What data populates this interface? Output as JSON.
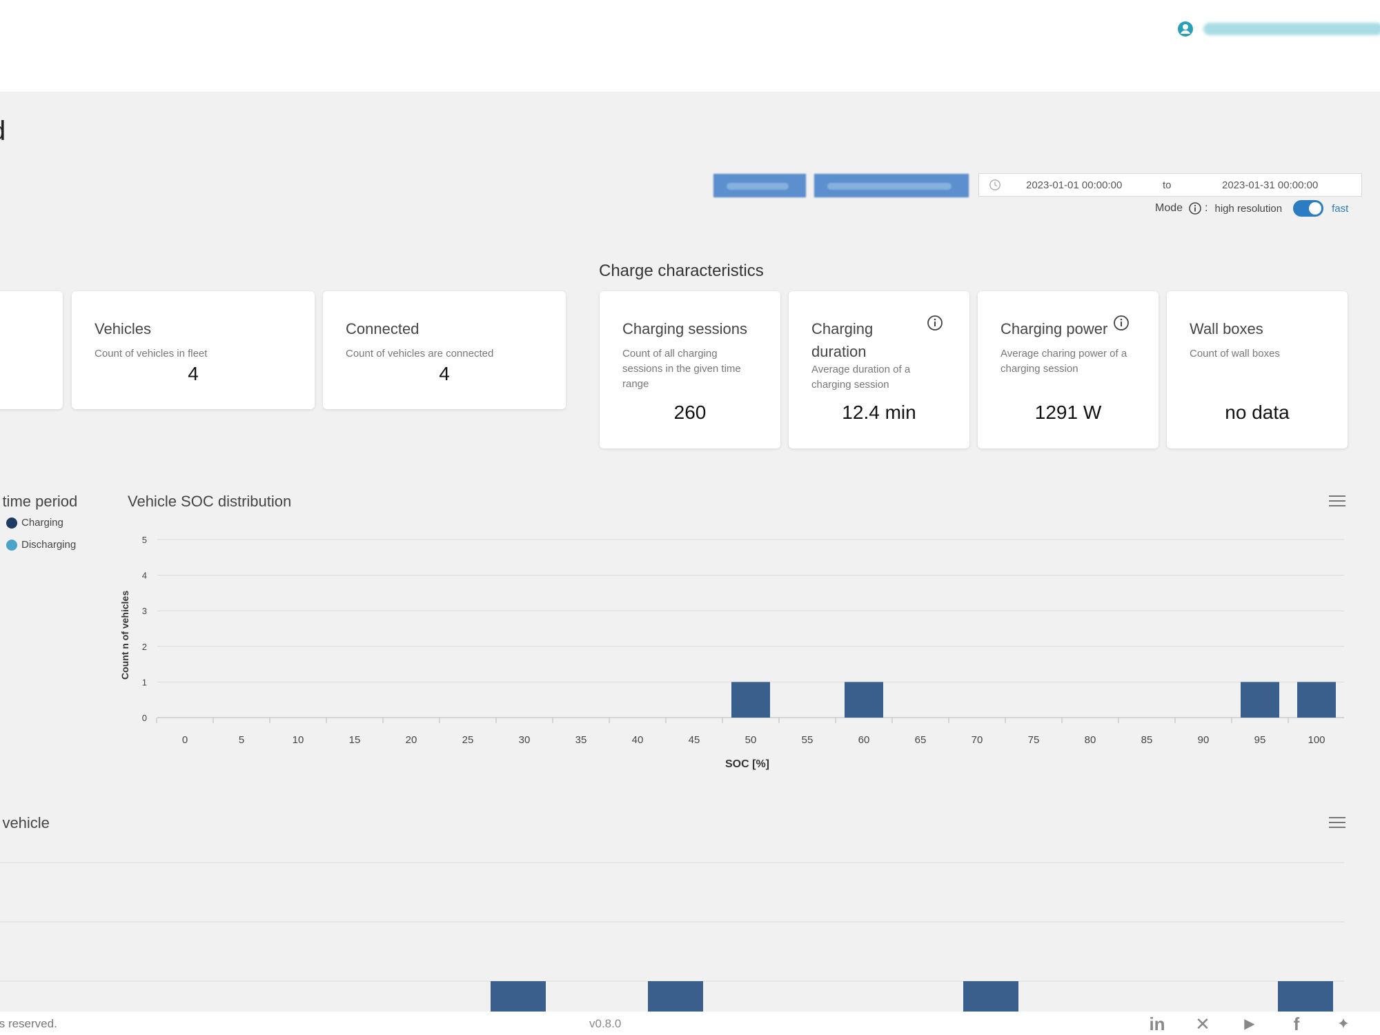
{
  "header": {
    "title": "d"
  },
  "filters": {
    "date_from": "2023-01-01 00:00:00",
    "date_separator": "to",
    "date_to": "2023-01-31 00:00:00",
    "mode_label": "Mode",
    "mode_colon": ":",
    "mode_left": "high resolution",
    "mode_right": "fast"
  },
  "fleet_cards": [
    {
      "title": "Vehicles",
      "description": "Count of vehicles in fleet",
      "value": "4"
    },
    {
      "title": "Connected",
      "description": "Count of vehicles are connected",
      "value": "4"
    }
  ],
  "charge": {
    "section_title": "Charge characteristics",
    "cards": [
      {
        "title_line1": "Charging sessions",
        "title_line2": "",
        "description": "Count of all charging sessions in the given time range",
        "value": "260"
      },
      {
        "title_line1": "Charging",
        "title_line2": "duration",
        "description": "Average duration of a charging session",
        "value": "12.4 min"
      },
      {
        "title_line1": "Charging power",
        "title_line2": "",
        "description": "Average charing power of a charging session",
        "value": "1291 W"
      },
      {
        "title_line1": "Wall boxes",
        "title_line2": "",
        "description": "Count of wall boxes",
        "value": "no data"
      }
    ]
  },
  "left_panel": {
    "title": "r time period",
    "legend": [
      {
        "name": "Charging",
        "color": "#1f3b63"
      },
      {
        "name": "Discharging",
        "color": "#4aa3c8"
      }
    ]
  },
  "bottom_panel": {
    "title": "r vehicle"
  },
  "footer": {
    "copyright": "ts reserved.",
    "version": "v0.8.0",
    "social": [
      "linkedin-icon",
      "xing-icon",
      "youtube-icon",
      "facebook-icon",
      "twitter-icon"
    ]
  },
  "colors": {
    "bar": "#3b5f8c",
    "accent": "#2c7cc4",
    "filter_button": "#5b8fcd"
  },
  "chart_data": {
    "type": "bar",
    "title": "Vehicle SOC distribution",
    "xlabel": "SOC [%]",
    "ylabel": "Count n of vehicles",
    "x": [
      0,
      5,
      10,
      15,
      20,
      25,
      30,
      35,
      40,
      45,
      50,
      55,
      60,
      65,
      70,
      75,
      80,
      85,
      90,
      95,
      100
    ],
    "values": [
      0,
      0,
      0,
      0,
      0,
      0,
      0,
      0,
      0,
      0,
      1,
      0,
      1,
      0,
      0,
      0,
      0,
      0,
      0,
      1,
      1
    ],
    "yticks": [
      0,
      1,
      2,
      3,
      4,
      5
    ],
    "ylim": [
      0,
      5
    ],
    "grid": true
  }
}
